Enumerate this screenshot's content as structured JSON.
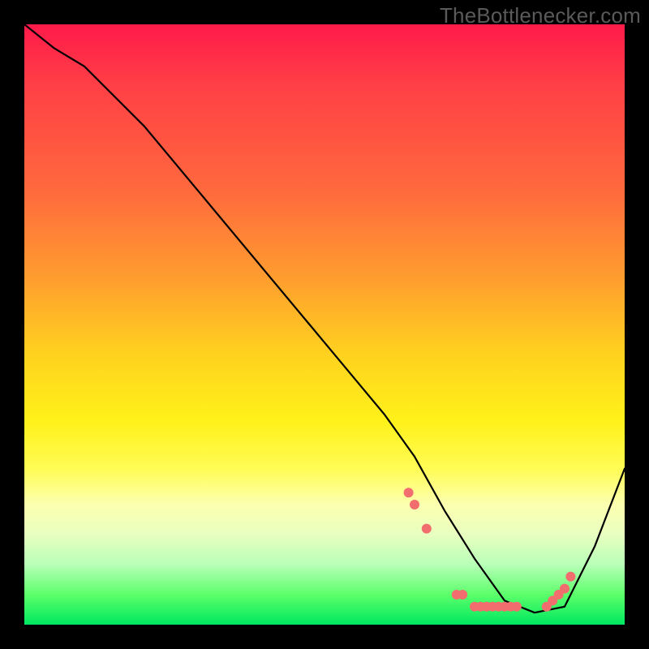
{
  "watermark": "TheBottlenecker.com",
  "chart_data": {
    "type": "line",
    "title": "",
    "xlabel": "",
    "ylabel": "",
    "xlim": [
      0,
      100
    ],
    "ylim": [
      0,
      100
    ],
    "series": [
      {
        "name": "curve",
        "x": [
          0,
          5,
          10,
          20,
          30,
          40,
          50,
          60,
          65,
          70,
          75,
          80,
          85,
          90,
          95,
          100
        ],
        "y": [
          100,
          96,
          93,
          83,
          71,
          59,
          47,
          35,
          28,
          19,
          11,
          4,
          2,
          3,
          13,
          26
        ]
      }
    ],
    "markers": {
      "name": "highlight-points",
      "color": "#f26d6d",
      "x": [
        64,
        65,
        67,
        72,
        73,
        75,
        76,
        77,
        78,
        79,
        80,
        81,
        82,
        87,
        88,
        89,
        90,
        91
      ],
      "y": [
        22,
        20,
        16,
        5,
        5,
        3,
        3,
        3,
        3,
        3,
        3,
        3,
        3,
        3,
        4,
        5,
        6,
        8
      ]
    },
    "gradient_stops": [
      {
        "pos": 0.0,
        "color": "#ff1a4a"
      },
      {
        "pos": 0.28,
        "color": "#ff6a3d"
      },
      {
        "pos": 0.55,
        "color": "#ffd21f"
      },
      {
        "pos": 0.74,
        "color": "#fffc55"
      },
      {
        "pos": 0.9,
        "color": "#b8ffb8"
      },
      {
        "pos": 1.0,
        "color": "#00e860"
      }
    ]
  }
}
